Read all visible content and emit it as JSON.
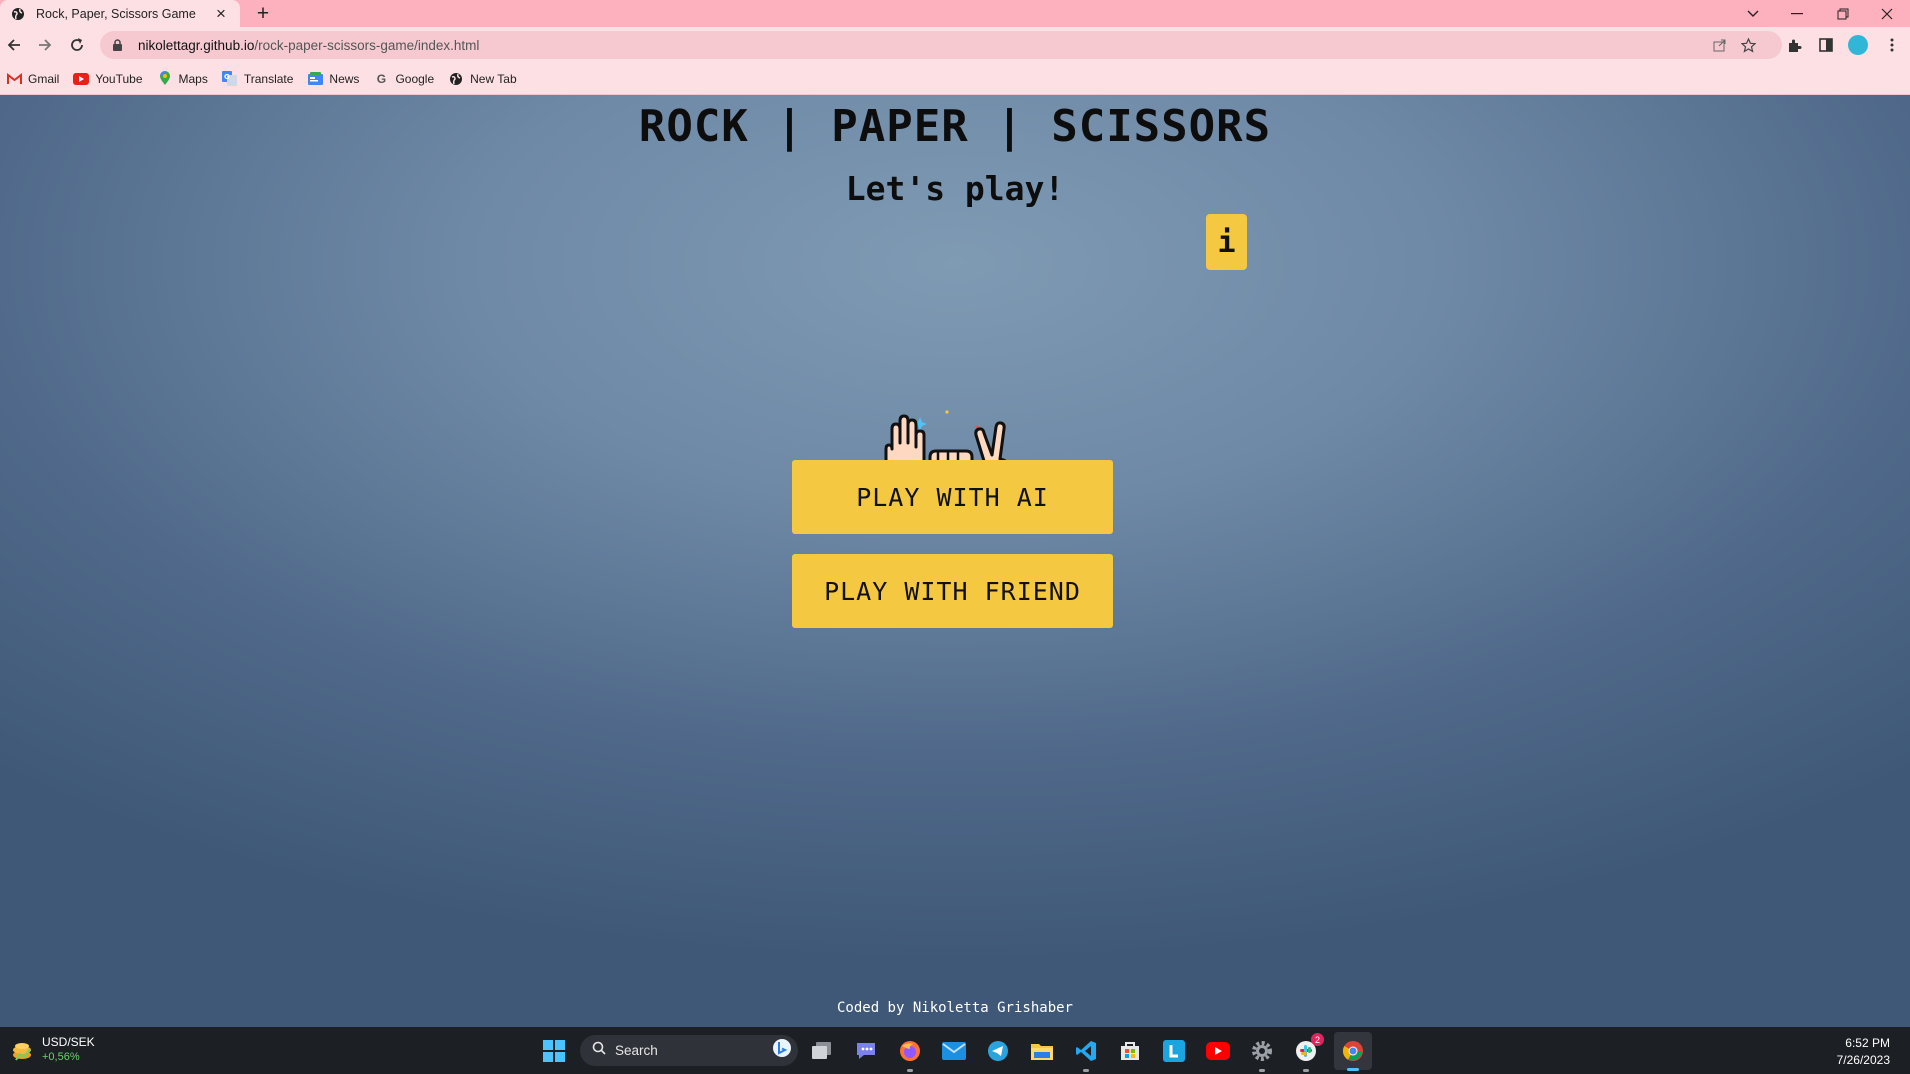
{
  "browser": {
    "tab_title": "Rock, Paper, Scissors Game",
    "url_host": "nikolettagr.github.io",
    "url_path": "/rock-paper-scissors-game/index.html",
    "bookmarks": [
      {
        "label": "Gmail",
        "icon": "gmail-icon"
      },
      {
        "label": "YouTube",
        "icon": "youtube-icon"
      },
      {
        "label": "Maps",
        "icon": "maps-icon"
      },
      {
        "label": "Translate",
        "icon": "translate-icon"
      },
      {
        "label": "News",
        "icon": "news-icon"
      },
      {
        "label": "Google",
        "icon": "google-icon"
      },
      {
        "label": "New Tab",
        "icon": "globe-icon"
      }
    ]
  },
  "game": {
    "title": "ROCK | PAPER | SCISSORS",
    "subtitle": "Let's play!",
    "info_label": "i",
    "play_ai_label": "PLAY WITH AI",
    "play_friend_label": "PLAY WITH FRIEND",
    "credit": "Coded by Nikoletta Grishaber",
    "accent_color": "#f5c842"
  },
  "taskbar": {
    "widget_title": "USD/SEK",
    "widget_change": "+0,56%",
    "search_placeholder": "Search",
    "time": "6:52 PM",
    "date": "7/26/2023",
    "notification_count": "2"
  }
}
